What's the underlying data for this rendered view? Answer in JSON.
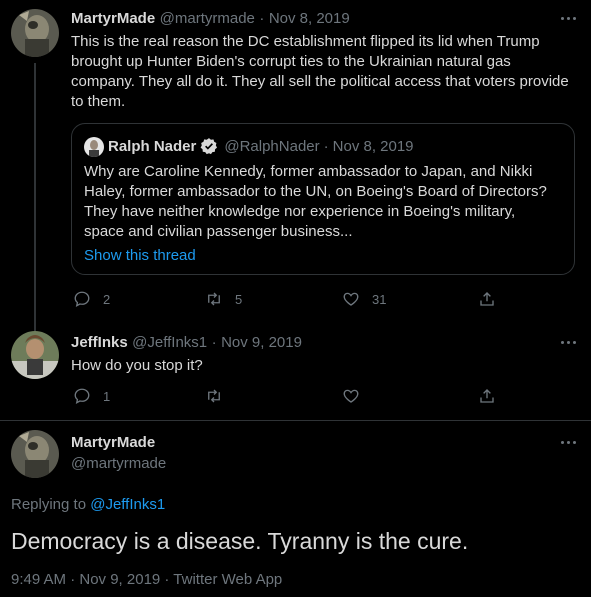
{
  "tweet1": {
    "display_name": "MartyrMade",
    "handle": "@martyrmade",
    "separator": "·",
    "date": "Nov 8, 2019",
    "text": "This is the real reason the DC establishment flipped its lid when Trump brought up Hunter Biden's corrupt ties to the Ukrainian natural gas company. They all do it. They all sell the political access that voters provide to them.",
    "quoted": {
      "display_name": "Ralph Nader",
      "handle": "@RalphNader",
      "separator": "·",
      "date": "Nov 8, 2019",
      "text": "Why are Caroline Kennedy, former ambassador to Japan, and Nikki Haley, former ambassador to the UN, on Boeing's Board of Directors? They have neither knowledge nor experience in Boeing's military, space and civilian passenger business...",
      "show_thread": "Show this thread"
    },
    "replies": "2",
    "retweets": "5",
    "likes": "31"
  },
  "tweet2": {
    "display_name": "JeffInks",
    "handle": "@JeffInks1",
    "separator": "·",
    "date": "Nov 9, 2019",
    "text": "How do you stop it?",
    "replies": "1"
  },
  "main_tweet": {
    "display_name": "MartyrMade",
    "handle": "@martyrmade",
    "replying_prefix": "Replying to",
    "replying_to": "@JeffInks1",
    "text": "Democracy is a disease. Tyranny is the cure.",
    "timestamp": "9:49 AM · Nov 9, 2019 · Twitter Web App"
  },
  "colors": {
    "background": "#000000",
    "text": "#d9d9d9",
    "muted": "#6e767d",
    "accent": "#1d9bf0",
    "border": "#2f3336"
  },
  "icons": [
    "more-icon",
    "reply-icon",
    "retweet-icon",
    "like-icon",
    "share-icon",
    "verified-badge-icon"
  ]
}
